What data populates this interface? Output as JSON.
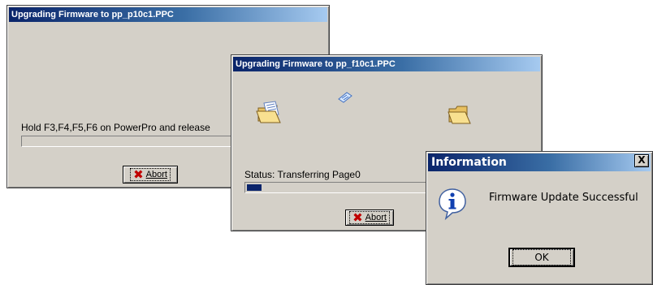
{
  "window1": {
    "title": "Upgrading Firmware to pp_p10c1.PPC",
    "instruction": "Hold F3,F4,F5,F6 on PowerPro and release",
    "abort_label": "Abort",
    "progress": 0
  },
  "window2": {
    "title": "Upgrading Firmware to pp_f10c1.PPC",
    "status": "Status: Transferring Page0",
    "abort_label": "Abort",
    "progress": 0.07,
    "icons": [
      "open-folder-source-icon",
      "flying-document-icon",
      "open-folder-destination-icon"
    ]
  },
  "info_dialog": {
    "title": "Information",
    "close_glyph": "X",
    "message": "Firmware Update Successful",
    "ok_label": "OK",
    "icon": "info-icon"
  }
}
